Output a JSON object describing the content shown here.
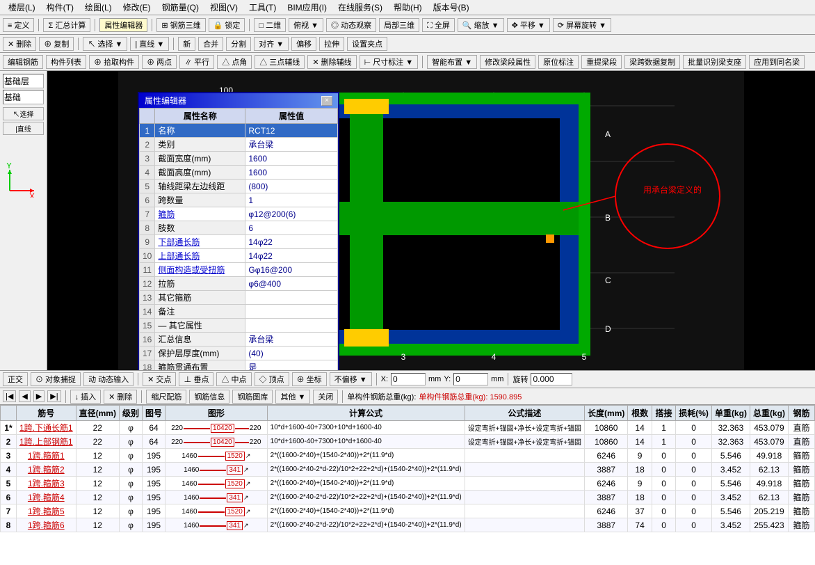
{
  "app": {
    "title": "属性编辑器",
    "menu": [
      "楼层(L)",
      "构件(T)",
      "绘图(L)",
      "修改(E)",
      "钢筋量(Q)",
      "视图(V)",
      "工具(T)",
      "BIM应用(I)",
      "在线服务(S)",
      "帮助(H)",
      "版本号(B)"
    ]
  },
  "toolbar1": {
    "items": [
      "定义",
      "汇总计算",
      "属性编辑器",
      "钢筋三维",
      "锁定",
      "二维",
      "俯视",
      "动态观察",
      "局部三维",
      "全屏",
      "缩放",
      "平移",
      "屏幕旋转"
    ]
  },
  "toolbar2": {
    "items": [
      "删除",
      "复制",
      "选择",
      "直线",
      "新",
      "合并",
      "分割",
      "对齐",
      "偏移",
      "拉伸",
      "设置夹点"
    ]
  },
  "toolbar3": {
    "items": [
      "编辑钢筋",
      "构件列表",
      "拾取构件",
      "两点",
      "平行",
      "点角",
      "三点辅线",
      "删除辅线",
      "尺寸标注"
    ]
  },
  "toolbar4": {
    "items": [
      "智能布置",
      "修改梁段属性",
      "原位标注",
      "重提梁段",
      "梁跨数据复制",
      "批量识别梁支座",
      "应用到同名梁"
    ]
  },
  "left_panel": {
    "layer_label": "基础层",
    "layer_type": "基础"
  },
  "prop_dialog": {
    "title": "属性编辑器",
    "close": "×",
    "columns": [
      "属性名称",
      "属性值"
    ],
    "rows": [
      {
        "id": 1,
        "name": "名称",
        "value": "RCT12",
        "selected": true
      },
      {
        "id": 2,
        "name": "类别",
        "value": "承台梁"
      },
      {
        "id": 3,
        "name": "截面宽度(mm)",
        "value": "1600"
      },
      {
        "id": 4,
        "name": "截面高度(mm)",
        "value": "1600"
      },
      {
        "id": 5,
        "name": "轴线距梁左边线距",
        "value": "(800)"
      },
      {
        "id": 6,
        "name": "跨数量",
        "value": "1"
      },
      {
        "id": 7,
        "name": "箍筋",
        "value": "φ12@200(6)",
        "is_link": true
      },
      {
        "id": 8,
        "name": "肢数",
        "value": "6"
      },
      {
        "id": 9,
        "name": "下部通长筋",
        "value": "14φ22",
        "is_link": true
      },
      {
        "id": 10,
        "name": "上部通长筋",
        "value": "14φ22",
        "is_link": true
      },
      {
        "id": 11,
        "name": "侧面构造或受扭筋",
        "value": "Gφ16@200",
        "is_link": true
      },
      {
        "id": 12,
        "name": "拉筋",
        "value": "φ6@400"
      },
      {
        "id": 13,
        "name": "其它箍筋",
        "value": ""
      },
      {
        "id": 14,
        "name": "备注",
        "value": ""
      },
      {
        "id": 15,
        "name": "— 其它属性",
        "value": "",
        "is_group": true
      },
      {
        "id": 16,
        "name": "汇总信息",
        "value": "承台梁"
      },
      {
        "id": 17,
        "name": "保护层厚度(mm)",
        "value": "(40)"
      },
      {
        "id": 18,
        "name": "箍筋贯通布置",
        "value": "是"
      }
    ]
  },
  "annotation": {
    "text": "用承台梁定义的",
    "circle_note": "annotation circle on drawing"
  },
  "bottom_toolbar": {
    "items": [
      "正交",
      "对象捕捉",
      "动态输入",
      "交点",
      "垂点",
      "中点",
      "顶点",
      "坐标",
      "不偏移"
    ],
    "x_label": "X:",
    "x_value": "0",
    "y_label": "Y:",
    "y_value": "0",
    "mm_label": "mm",
    "rotate_label": "旋转",
    "rotate_value": "0.000"
  },
  "data_header": {
    "nav_items": [
      "插入",
      "删除",
      "缩尺配筋",
      "钢筋信息",
      "钢筋图库",
      "其他",
      "关闭"
    ],
    "total_weight": "单构件钢筋总重(kg): 1590.895"
  },
  "data_table": {
    "columns": [
      "筋号",
      "直径(mm)",
      "级别",
      "图号",
      "图形",
      "计算公式",
      "公式描述",
      "长度(mm)",
      "根数",
      "搭接",
      "损耗(%)",
      "单重(kg)",
      "总重(kg)",
      "钢筋"
    ],
    "rows": [
      {
        "row_num": "1*",
        "bar_num": "1跨.下通长筋1",
        "diameter": "22",
        "grade": "φ",
        "fig_num": "64",
        "shape_left": "220",
        "shape_middle": "10420",
        "shape_right": "220",
        "formula": "10*d+1600-40+7300+10*d+1600-40",
        "desc": "设定弯折+锚固+净长+设定弯折+锚固",
        "length": "10860",
        "count": "14",
        "splice": "1",
        "loss": "0",
        "unit_wt": "32.363",
        "total_wt": "453.079",
        "type": "直筋"
      },
      {
        "row_num": "2",
        "bar_num": "1跨.上部钢筋1",
        "diameter": "22",
        "grade": "φ",
        "fig_num": "64",
        "shape_left": "220",
        "shape_middle": "10420",
        "shape_right": "220",
        "formula": "10*d+1600-40+7300+10*d+1600-40",
        "desc": "设定弯折+锚固+净长+设定弯折+锚固",
        "length": "10860",
        "count": "14",
        "splice": "1",
        "loss": "0",
        "unit_wt": "32.363",
        "total_wt": "453.079",
        "type": "直筋"
      },
      {
        "row_num": "3",
        "bar_num": "1跨.箍筋1",
        "diameter": "12",
        "grade": "φ",
        "fig_num": "195",
        "shape_left": "1460",
        "shape_middle": "1520",
        "shape_right": "",
        "formula": "2*((1600-2*40)+(1540-2*40))+2*(11.9*d)",
        "desc": "",
        "length": "6246",
        "count": "9",
        "splice": "0",
        "loss": "0",
        "unit_wt": "5.546",
        "total_wt": "49.918",
        "type": "箍筋"
      },
      {
        "row_num": "4",
        "bar_num": "1跨.箍筋2",
        "diameter": "12",
        "grade": "φ",
        "fig_num": "195",
        "shape_left": "1460",
        "shape_middle": "341",
        "shape_right": "",
        "formula": "2*((1600-2*40-2*d-22)/10*2+22+2*d)+(1540-2*40))+2*(11.9*d)",
        "desc": "",
        "length": "3887",
        "count": "18",
        "splice": "0",
        "loss": "0",
        "unit_wt": "3.452",
        "total_wt": "62.13",
        "type": "箍筋"
      },
      {
        "row_num": "5",
        "bar_num": "1跨.箍筋3",
        "diameter": "12",
        "grade": "φ",
        "fig_num": "195",
        "shape_left": "1460",
        "shape_middle": "1520",
        "shape_right": "",
        "formula": "2*((1600-2*40)+(1540-2*40))+2*(11.9*d)",
        "desc": "",
        "length": "6246",
        "count": "9",
        "splice": "0",
        "loss": "0",
        "unit_wt": "5.546",
        "total_wt": "49.918",
        "type": "箍筋"
      },
      {
        "row_num": "6",
        "bar_num": "1跨.箍筋4",
        "diameter": "12",
        "grade": "φ",
        "fig_num": "195",
        "shape_left": "1460",
        "shape_middle": "341",
        "shape_right": "",
        "formula": "2*((1600-2*40-2*d-22)/10*2+22+2*d)+(1540-2*40))+2*(11.9*d)",
        "desc": "",
        "length": "3887",
        "count": "18",
        "splice": "0",
        "loss": "0",
        "unit_wt": "3.452",
        "total_wt": "62.13",
        "type": "箍筋"
      },
      {
        "row_num": "7",
        "bar_num": "1跨.箍筋5",
        "diameter": "12",
        "grade": "φ",
        "fig_num": "195",
        "shape_left": "1460",
        "shape_middle": "1520",
        "shape_right": "",
        "formula": "2*((1600-2*40)+(1540-2*40))+2*(11.9*d)",
        "desc": "",
        "length": "6246",
        "count": "37",
        "splice": "0",
        "loss": "0",
        "unit_wt": "5.546",
        "total_wt": "205.219",
        "type": "箍筋"
      },
      {
        "row_num": "8",
        "bar_num": "1跨.箍筋6",
        "diameter": "12",
        "grade": "φ",
        "fig_num": "195",
        "shape_left": "1460",
        "shape_middle": "341",
        "shape_right": "",
        "formula": "2*((1600-2*40-2*d-22)/10*2+22+2*d)+(1540-2*40))+2*(11.9*d)",
        "desc": "",
        "length": "3887",
        "count": "74",
        "splice": "0",
        "loss": "0",
        "unit_wt": "3.452",
        "total_wt": "255.423",
        "type": "箍筋"
      }
    ]
  }
}
